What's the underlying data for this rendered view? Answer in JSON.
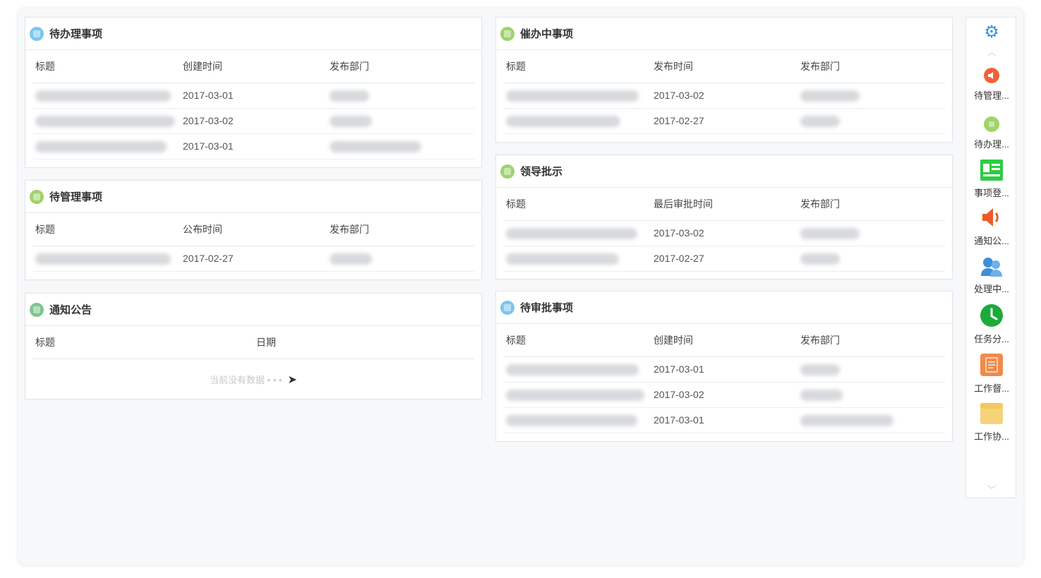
{
  "panels": {
    "todo": {
      "title": "待办理事项",
      "headers": [
        "标题",
        "创建时间",
        "发布部门"
      ],
      "dates": [
        "2017-03-01",
        "2017-03-02",
        "2017-03-01"
      ]
    },
    "manage": {
      "title": "待管理事项",
      "headers": [
        "标题",
        "公布时间",
        "发布部门"
      ],
      "dates": [
        "2017-02-27"
      ]
    },
    "notice": {
      "title": "通知公告",
      "headers": [
        "标题",
        "日期"
      ],
      "empty_text": "当前没有数据 • • •"
    },
    "urging": {
      "title": "催办中事项",
      "headers": [
        "标题",
        "发布时间",
        "发布部门"
      ],
      "dates": [
        "2017-03-02",
        "2017-02-27"
      ]
    },
    "leader": {
      "title": "领导批示",
      "headers": [
        "标题",
        "最后审批时间",
        "发布部门"
      ],
      "dates": [
        "2017-03-02",
        "2017-02-27"
      ]
    },
    "approve": {
      "title": "待审批事项",
      "headers": [
        "标题",
        "创建时间",
        "发布部门"
      ],
      "dates": [
        "2017-03-01",
        "2017-03-02",
        "2017-03-01"
      ]
    }
  },
  "sidebar": {
    "items": [
      {
        "label": "待管理...",
        "icon": "speaker-circle-icon",
        "color": "#f0633a"
      },
      {
        "label": "待办理...",
        "icon": "green-circle-icon",
        "color": "#9ed36a"
      },
      {
        "label": "事项登...",
        "icon": "id-card-icon",
        "color": "#2ecc40"
      },
      {
        "label": "通知公...",
        "icon": "speaker-icon",
        "color": "#f05a24"
      },
      {
        "label": "处理中...",
        "icon": "users-icon",
        "color": "#3e8fd9"
      },
      {
        "label": "任务分...",
        "icon": "clock-icon",
        "color": "#1aaa3a"
      },
      {
        "label": "工作督...",
        "icon": "clipboard-icon",
        "color": "#f08a4b"
      },
      {
        "label": "工作协...",
        "icon": "folder-icon",
        "color": "#f6d27a"
      }
    ]
  }
}
